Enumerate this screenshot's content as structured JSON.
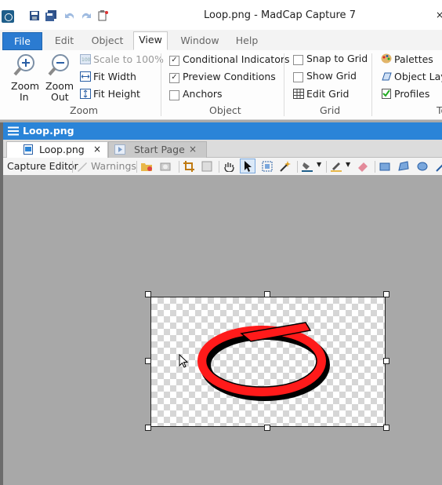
{
  "window": {
    "title": "Loop.png - MadCap Capture 7",
    "close_glyph": "×"
  },
  "ribbon_tabs": [
    {
      "label": "File"
    },
    {
      "label": "Edit"
    },
    {
      "label": "Object"
    },
    {
      "label": "View"
    },
    {
      "label": "Window"
    },
    {
      "label": "Help"
    }
  ],
  "active_tab": "View",
  "zoom_group": {
    "label": "Zoom",
    "zoom_in": "Zoom\nIn",
    "zoom_in_l1": "Zoom",
    "zoom_in_l2": "In",
    "zoom_out_l1": "Zoom",
    "zoom_out_l2": "Out",
    "scale": "Scale to 100%",
    "fit_width": "Fit Width",
    "fit_height": "Fit Height"
  },
  "object_group": {
    "label": "Object",
    "conditional": {
      "label": "Conditional Indicators",
      "checked": true
    },
    "preview": {
      "label": "Preview Conditions",
      "checked": true
    },
    "anchors": {
      "label": "Anchors",
      "checked": false
    }
  },
  "grid_group": {
    "label": "Grid",
    "snap": {
      "label": "Snap to Grid",
      "checked": false
    },
    "show": {
      "label": "Show Grid",
      "checked": false
    },
    "edit": "Edit Grid"
  },
  "misc_group": {
    "palettes": "Palettes",
    "layers": "Object Layer",
    "profiles": "Profiles",
    "label_partial": "To"
  },
  "document": {
    "title": "Loop.png",
    "tabs": [
      {
        "label": "Loop.png",
        "active": true
      },
      {
        "label": "Start Page",
        "active": false
      }
    ],
    "tab_close": "×"
  },
  "editor_toolbar": {
    "capture_editor": "Capture Editor",
    "warnings": "Warnings"
  },
  "colors": {
    "accent": "#2a84d8",
    "file_tab": "#2b7bd1",
    "loop": "#ff1a1a"
  }
}
